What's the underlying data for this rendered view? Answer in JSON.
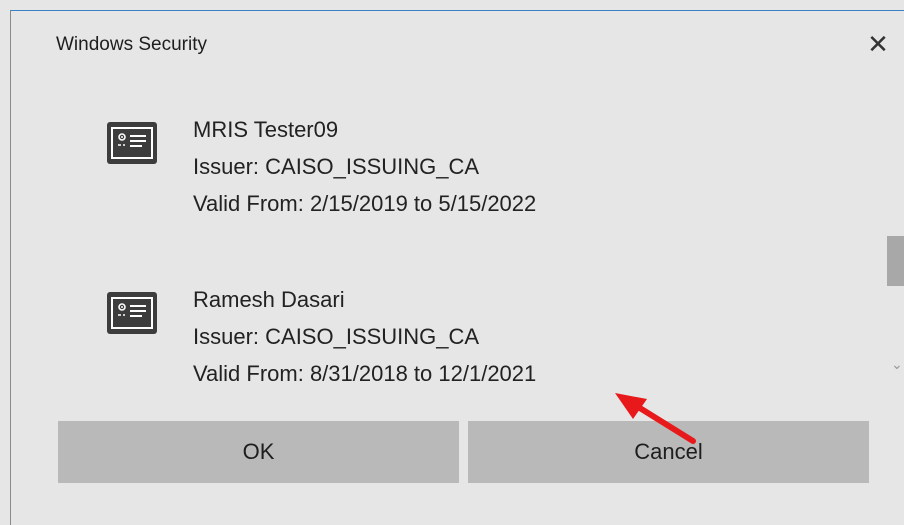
{
  "window": {
    "title": "Windows Security",
    "close_glyph": "✕"
  },
  "certificates": [
    {
      "name": "MRIS Tester09",
      "issuer": "Issuer: CAISO_ISSUING_CA",
      "valid": "Valid From: 2/15/2019 to 5/15/2022",
      "icon": "certificate-icon"
    },
    {
      "name": "Ramesh Dasari",
      "issuer": "Issuer: CAISO_ISSUING_CA",
      "valid": "Valid From: 8/31/2018 to 12/1/2021",
      "icon": "certificate-icon"
    }
  ],
  "buttons": {
    "ok_label": "OK",
    "cancel_label": "Cancel"
  },
  "annotation": {
    "arrow_color": "#e8191b"
  },
  "colors": {
    "dialog_bg": "#e6e6e6",
    "button_bg": "#b9b9b9",
    "title_border": "#3b82c4"
  }
}
